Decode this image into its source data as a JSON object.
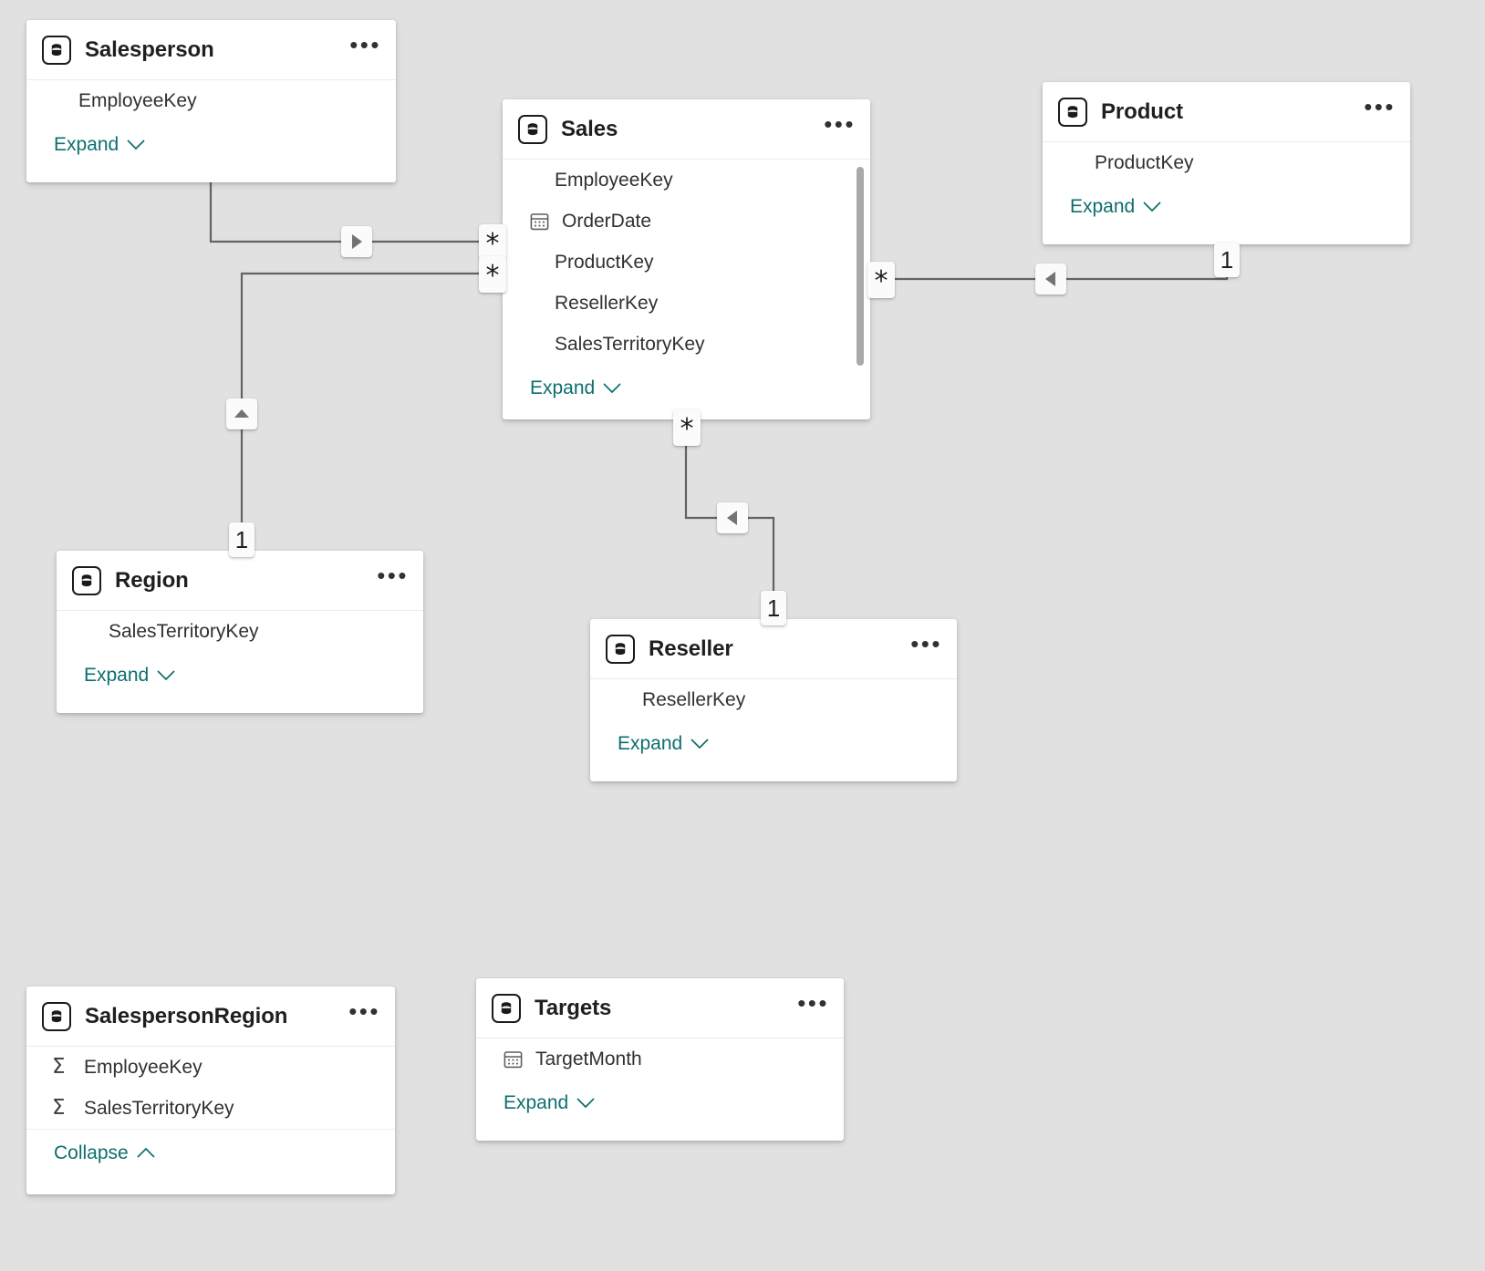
{
  "app": {
    "view_name": "model-diagram",
    "canvas_background": "#e1e1e1",
    "card_background": "#ffffff",
    "link_color": "#0e6e6e",
    "line_color": "#636363"
  },
  "labels": {
    "expand": "Expand",
    "collapse": "Collapse",
    "ellipsis": "•••",
    "chevron_down": "∨",
    "chevron_up": "∧",
    "sigma": "Σ",
    "star": "✱"
  },
  "tables": [
    {
      "id": "salesperson",
      "name": "Salesperson",
      "icon": "table-icon",
      "fields": [
        {
          "name": "EmployeeKey",
          "icon": "none"
        }
      ],
      "footer": {
        "label": "Expand",
        "state": "collapsed"
      },
      "scrollbar": false
    },
    {
      "id": "sales",
      "name": "Sales",
      "icon": "table-icon",
      "fields": [
        {
          "name": "EmployeeKey",
          "icon": "none"
        },
        {
          "name": "OrderDate",
          "icon": "calendar-icon"
        },
        {
          "name": "ProductKey",
          "icon": "none"
        },
        {
          "name": "ResellerKey",
          "icon": "none"
        },
        {
          "name": "SalesTerritoryKey",
          "icon": "none"
        }
      ],
      "footer": {
        "label": "Expand",
        "state": "collapsed"
      },
      "scrollbar": true
    },
    {
      "id": "product",
      "name": "Product",
      "icon": "table-icon",
      "fields": [
        {
          "name": "ProductKey",
          "icon": "none"
        }
      ],
      "footer": {
        "label": "Expand",
        "state": "collapsed"
      },
      "scrollbar": false
    },
    {
      "id": "region",
      "name": "Region",
      "icon": "table-icon",
      "fields": [
        {
          "name": "SalesTerritoryKey",
          "icon": "none"
        }
      ],
      "footer": {
        "label": "Expand",
        "state": "collapsed"
      },
      "scrollbar": false
    },
    {
      "id": "reseller",
      "name": "Reseller",
      "icon": "table-icon",
      "fields": [
        {
          "name": "ResellerKey",
          "icon": "none"
        }
      ],
      "footer": {
        "label": "Expand",
        "state": "collapsed"
      },
      "scrollbar": false
    },
    {
      "id": "salespersonregion",
      "name": "SalespersonRegion",
      "icon": "table-icon",
      "fields": [
        {
          "name": "EmployeeKey",
          "icon": "sigma-icon"
        },
        {
          "name": "SalesTerritoryKey",
          "icon": "sigma-icon"
        }
      ],
      "footer": {
        "label": "Collapse",
        "state": "expanded"
      },
      "scrollbar": false
    },
    {
      "id": "targets",
      "name": "Targets",
      "icon": "table-icon",
      "fields": [
        {
          "name": "TargetMonth",
          "icon": "calendar-icon"
        }
      ],
      "footer": {
        "label": "Expand",
        "state": "collapsed"
      },
      "scrollbar": false
    }
  ],
  "relationships": [
    {
      "id": "salesperson-sales",
      "from": "Salesperson",
      "to": "Sales",
      "from_cardinality": "1",
      "to_cardinality": "*",
      "cross_filter_direction": "right"
    },
    {
      "id": "region-sales",
      "from": "Region",
      "to": "Sales",
      "from_cardinality": "1",
      "to_cardinality": "*",
      "cross_filter_direction": "up"
    },
    {
      "id": "product-sales",
      "from": "Product",
      "to": "Sales",
      "from_cardinality": "1",
      "to_cardinality": "*",
      "cross_filter_direction": "left"
    },
    {
      "id": "reseller-sales",
      "from": "Reseller",
      "to": "Sales",
      "from_cardinality": "1",
      "to_cardinality": "*",
      "cross_filter_direction": "left"
    }
  ],
  "badges": [
    {
      "id": "star-salesperson-sales",
      "text": "*"
    },
    {
      "id": "star-region-sales",
      "text": "*"
    },
    {
      "id": "star-product-sales",
      "text": "*"
    },
    {
      "id": "star-reseller-sales",
      "text": "*"
    },
    {
      "id": "one-product",
      "text": "1"
    },
    {
      "id": "one-region",
      "text": "1"
    },
    {
      "id": "one-reseller",
      "text": "1"
    }
  ]
}
